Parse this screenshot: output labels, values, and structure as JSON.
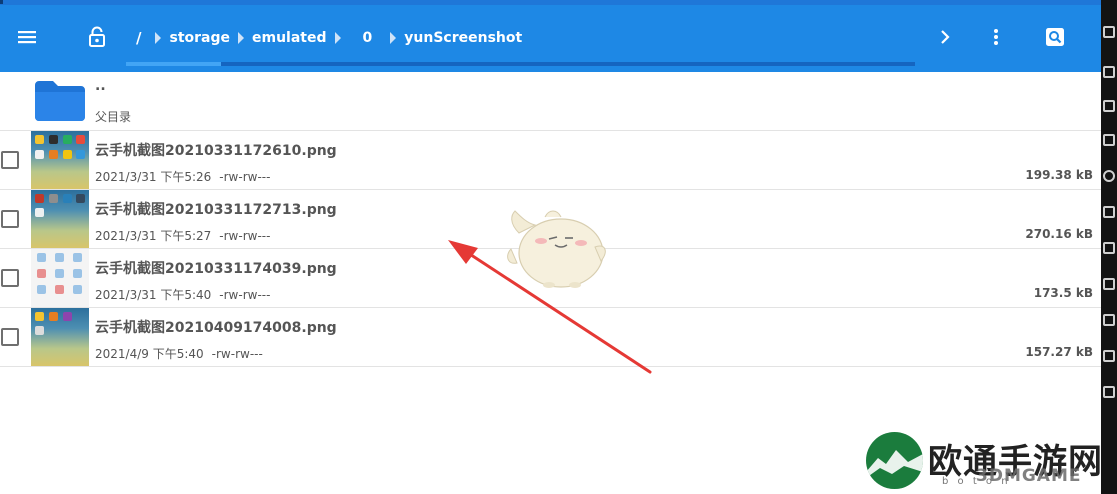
{
  "app": {
    "toolbar": {
      "root_separator": "/",
      "breadcrumbs": [
        {
          "label": "storage"
        },
        {
          "label": "emulated"
        },
        {
          "label": "0"
        },
        {
          "label": "yunScreenshot"
        }
      ],
      "icons": {
        "menu": "menu-icon",
        "lock": "lock-icon",
        "next": "chevron-right-icon",
        "more": "more-vert-icon",
        "search": "search-icon"
      },
      "colors": {
        "bar": "#1e88e5",
        "scroll_track": "#1565c0",
        "scroll_thumb": "#42a5f5"
      }
    },
    "parent": {
      "dots": "..",
      "label": "父目录"
    },
    "files": [
      {
        "name": "云手机截图20210331172610.png",
        "date": "2021/3/31 下午5:26",
        "perm": "-rw-rw---",
        "size": "199.38 kB",
        "thumb": "homescreen"
      },
      {
        "name": "云手机截图20210331172713.png",
        "date": "2021/3/31 下午5:27",
        "perm": "-rw-rw---",
        "size": "270.16 kB",
        "thumb": "homescreen"
      },
      {
        "name": "云手机截图20210331174039.png",
        "date": "2021/3/31 下午5:40",
        "perm": "-rw-rw---",
        "size": "173.5 kB",
        "thumb": "settings"
      },
      {
        "name": "云手机截图20210409174008.png",
        "date": "2021/4/9 下午5:40",
        "perm": "-rw-rw---",
        "size": "157.27 kB",
        "thumb": "homescreen"
      }
    ],
    "watermark": {
      "brand": "欧通手游网",
      "sub": "3DMGAME",
      "tiny": "b o t o n"
    },
    "annotation": {
      "arrow_color": "#e53935"
    }
  }
}
